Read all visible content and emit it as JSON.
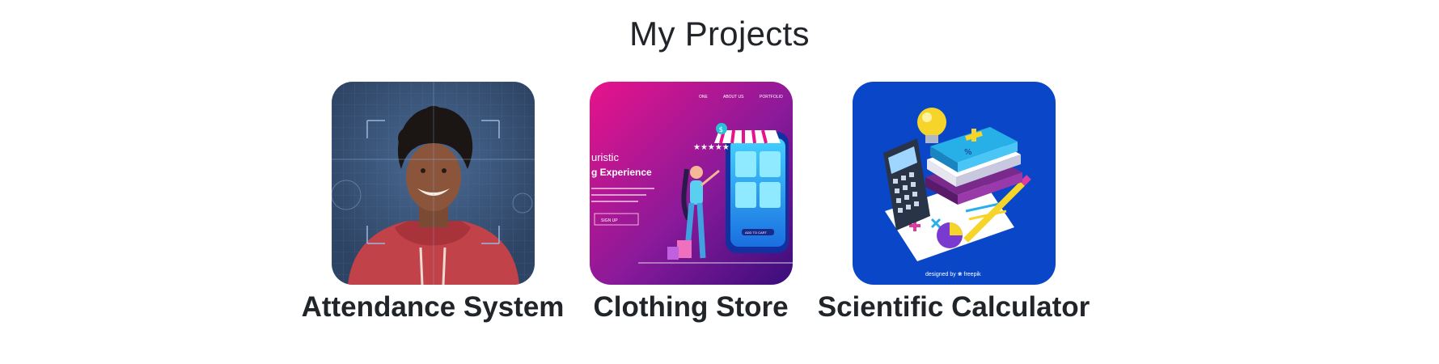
{
  "section": {
    "title": "My Projects"
  },
  "projects": [
    {
      "title": "Attendance System",
      "image_icon": "face-recognition-photo"
    },
    {
      "title": "Clothing Store",
      "image_icon": "ecommerce-illustration",
      "image_text": {
        "nav": [
          "ONE",
          "ABOUT US",
          "PORTFOLIO"
        ],
        "heading_1": "uristic",
        "heading_2": "g Experience",
        "button": "SIGN UP",
        "screen_button": "ADD TO CART"
      }
    },
    {
      "title": "Scientific Calculator",
      "image_icon": "calculator-books-illustration",
      "image_text": {
        "credit": "designed by ❀ freepik"
      }
    }
  ],
  "colors": {
    "text": "#212529",
    "attendance_bg": "#3a5170",
    "hoodie": "#c2424a",
    "store_gradient_start": "#e8138a",
    "store_gradient_end": "#5a0f8c",
    "calculator_bg": "#0a47c8"
  }
}
